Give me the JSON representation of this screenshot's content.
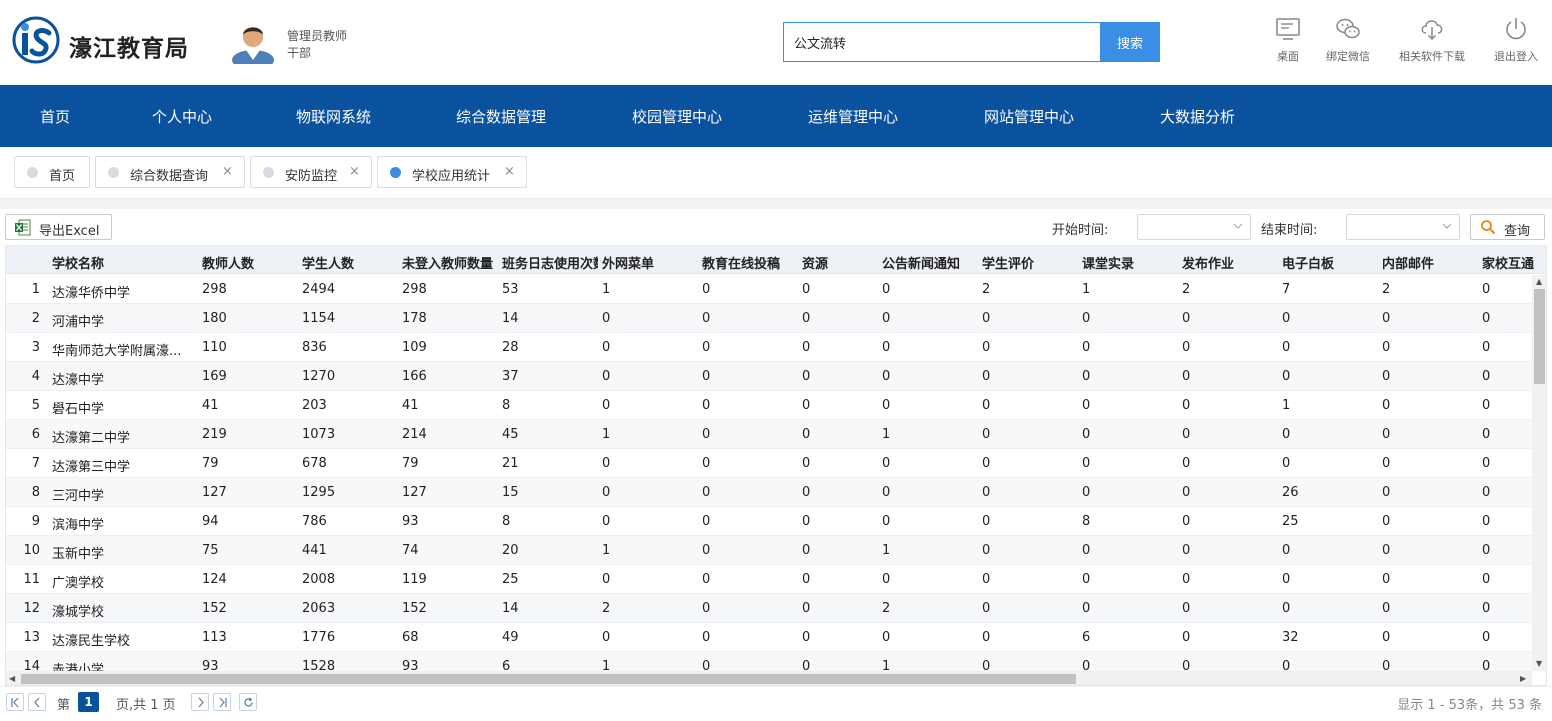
{
  "header": {
    "brand": "濠江教育局",
    "logo_text": "iS",
    "user_role": "管理员教师",
    "user_dept": "干部",
    "search_value": "公文流转",
    "search_button": "搜索",
    "tools": [
      {
        "label": "桌面",
        "icon": "monitor-icon"
      },
      {
        "label": "绑定微信",
        "icon": "wechat-icon"
      },
      {
        "label": "相关软件下载",
        "icon": "cloud-download-icon"
      },
      {
        "label": "退出登入",
        "icon": "power-icon"
      }
    ]
  },
  "nav": [
    "首页",
    "个人中心",
    "物联网系统",
    "综合数据管理",
    "校园管理中心",
    "运维管理中心",
    "网站管理中心",
    "大数据分析"
  ],
  "tabs": [
    {
      "label": "首页",
      "closable": false,
      "active": false
    },
    {
      "label": "综合数据查询",
      "closable": true,
      "active": false
    },
    {
      "label": "安防监控",
      "closable": true,
      "active": false
    },
    {
      "label": "学校应用统计",
      "closable": true,
      "active": true
    }
  ],
  "tab_close": "×",
  "toolbar": {
    "export_label": "导出Excel",
    "start_label": "开始时间:",
    "end_label": "结束时间:",
    "start_value": "",
    "end_value": "",
    "query_label": "查询"
  },
  "columns": [
    "学校名称",
    "教师人数",
    "学生人数",
    "未登入教师数量",
    "班务日志使用次数",
    "外网菜单",
    "教育在线投稿",
    "资源",
    "公告新闻通知",
    "学生评价",
    "课堂实录",
    "发布作业",
    "电子白板",
    "内部邮件",
    "家校互通"
  ],
  "rows": [
    [
      "1",
      "达濠华侨中学",
      "298",
      "2494",
      "298",
      "53",
      "1",
      "0",
      "0",
      "0",
      "2",
      "1",
      "2",
      "7",
      "2",
      "0"
    ],
    [
      "2",
      "河浦中学",
      "180",
      "1154",
      "178",
      "14",
      "0",
      "0",
      "0",
      "0",
      "0",
      "0",
      "0",
      "0",
      "0",
      "0"
    ],
    [
      "3",
      "华南师范大学附属濠...",
      "110",
      "836",
      "109",
      "28",
      "0",
      "0",
      "0",
      "0",
      "0",
      "0",
      "0",
      "0",
      "0",
      "0"
    ],
    [
      "4",
      "达濠中学",
      "169",
      "1270",
      "166",
      "37",
      "0",
      "0",
      "0",
      "0",
      "0",
      "0",
      "0",
      "0",
      "0",
      "0"
    ],
    [
      "5",
      "礐石中学",
      "41",
      "203",
      "41",
      "8",
      "0",
      "0",
      "0",
      "0",
      "0",
      "0",
      "0",
      "1",
      "0",
      "0"
    ],
    [
      "6",
      "达濠第二中学",
      "219",
      "1073",
      "214",
      "45",
      "1",
      "0",
      "0",
      "1",
      "0",
      "0",
      "0",
      "0",
      "0",
      "0"
    ],
    [
      "7",
      "达濠第三中学",
      "79",
      "678",
      "79",
      "21",
      "0",
      "0",
      "0",
      "0",
      "0",
      "0",
      "0",
      "0",
      "0",
      "0"
    ],
    [
      "8",
      "三河中学",
      "127",
      "1295",
      "127",
      "15",
      "0",
      "0",
      "0",
      "0",
      "0",
      "0",
      "0",
      "26",
      "0",
      "0"
    ],
    [
      "9",
      "滨海中学",
      "94",
      "786",
      "93",
      "8",
      "0",
      "0",
      "0",
      "0",
      "0",
      "8",
      "0",
      "25",
      "0",
      "0"
    ],
    [
      "10",
      "玉新中学",
      "75",
      "441",
      "74",
      "20",
      "1",
      "0",
      "0",
      "1",
      "0",
      "0",
      "0",
      "0",
      "0",
      "0"
    ],
    [
      "11",
      "广澳学校",
      "124",
      "2008",
      "119",
      "25",
      "0",
      "0",
      "0",
      "0",
      "0",
      "0",
      "0",
      "0",
      "0",
      "0"
    ],
    [
      "12",
      "濠城学校",
      "152",
      "2063",
      "152",
      "14",
      "2",
      "0",
      "0",
      "2",
      "0",
      "0",
      "0",
      "0",
      "0",
      "0"
    ],
    [
      "13",
      "达濠民生学校",
      "113",
      "1776",
      "68",
      "49",
      "0",
      "0",
      "0",
      "0",
      "0",
      "6",
      "0",
      "32",
      "0",
      "0"
    ],
    [
      "14",
      "赤港小学",
      "93",
      "1528",
      "93",
      "6",
      "1",
      "0",
      "0",
      "1",
      "0",
      "0",
      "0",
      "0",
      "0",
      "0"
    ]
  ],
  "pager": {
    "page_prefix": "第",
    "current_page": "1",
    "page_suffix": "页,共 1 页",
    "info": "显示 1 - 53条，共 53 条"
  }
}
